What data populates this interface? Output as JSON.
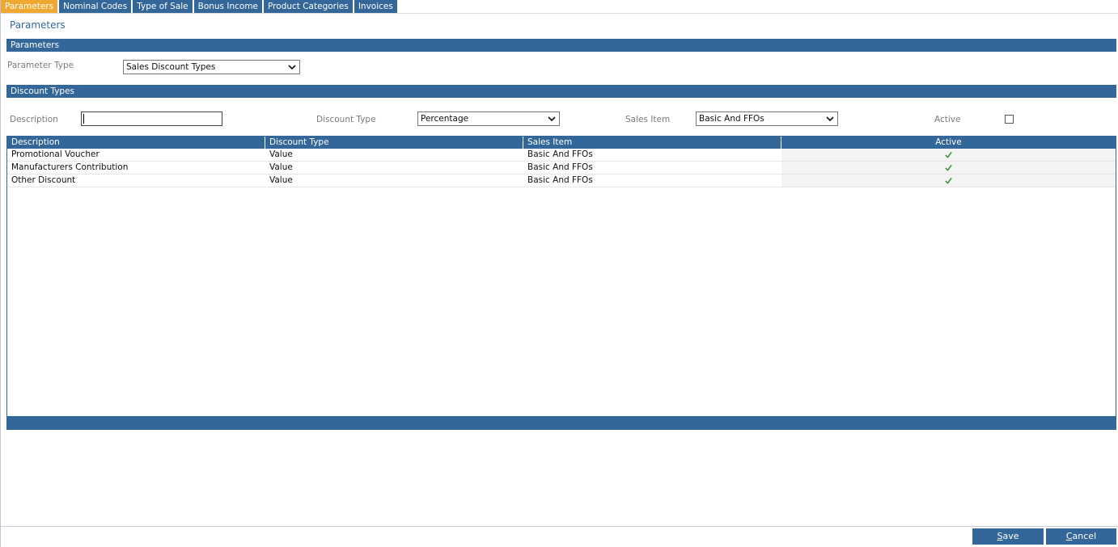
{
  "tabs": [
    {
      "label": "Parameters",
      "active": true
    },
    {
      "label": "Nominal Codes",
      "active": false
    },
    {
      "label": "Type of Sale",
      "active": false
    },
    {
      "label": "Bonus Income",
      "active": false
    },
    {
      "label": "Product Categories",
      "active": false
    },
    {
      "label": "Invoices",
      "active": false
    }
  ],
  "page_title": "Parameters",
  "parameters_section": {
    "title": "Parameters",
    "parameter_type_label": "Parameter Type",
    "parameter_type_value": "Sales Discount Types"
  },
  "discount_section": {
    "title": "Discount Types",
    "description_label": "Description",
    "description_value": "",
    "discount_type_label": "Discount Type",
    "discount_type_value": "Percentage",
    "sales_item_label": "Sales Item",
    "sales_item_value": "Basic And FFOs",
    "active_label": "Active",
    "active_checked": false
  },
  "grid": {
    "columns": [
      "Description",
      "Discount Type",
      "Sales Item",
      "Active"
    ],
    "rows": [
      {
        "description": "Promotional Voucher",
        "discount_type": "Value",
        "sales_item": "Basic And FFOs",
        "active": true
      },
      {
        "description": "Manufacturers Contribution",
        "discount_type": "Value",
        "sales_item": "Basic And FFOs",
        "active": true
      },
      {
        "description": "Other Discount",
        "discount_type": "Value",
        "sales_item": "Basic And FFOs",
        "active": true
      }
    ]
  },
  "buttons": {
    "save_first": "S",
    "save_rest": "ave",
    "cancel_first": "C",
    "cancel_rest": "ancel"
  },
  "colors": {
    "primary": "#336699",
    "active_tab": "#f0a830",
    "check": "#2e8b2e"
  }
}
